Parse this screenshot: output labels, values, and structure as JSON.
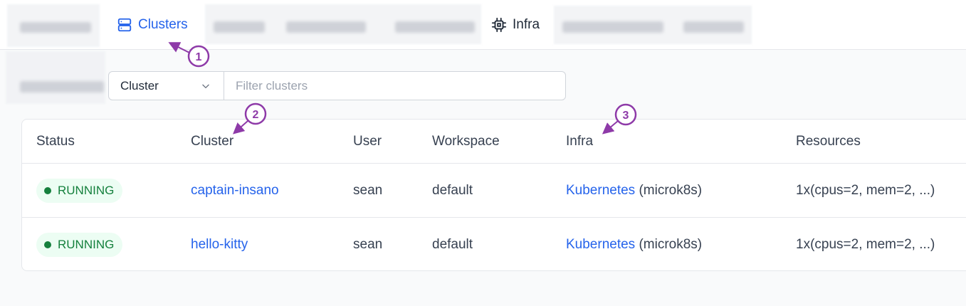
{
  "nav": {
    "tabs": [
      {
        "label": "Clusters",
        "icon": "server-stack-icon",
        "active": true
      },
      {
        "label": "Infra",
        "icon": "chip-icon",
        "active": false
      }
    ]
  },
  "filter": {
    "select_value": "Cluster",
    "placeholder": "Filter clusters"
  },
  "table": {
    "columns": [
      "Status",
      "Cluster",
      "User",
      "Workspace",
      "Infra",
      "Resources"
    ],
    "rows": [
      {
        "status": "RUNNING",
        "cluster": "captain-insano",
        "user": "sean",
        "workspace": "default",
        "infra_link": "Kubernetes",
        "infra_detail": "(microk8s)",
        "resources": "1x(cpus=2, mem=2, ...)"
      },
      {
        "status": "RUNNING",
        "cluster": "hello-kitty",
        "user": "sean",
        "workspace": "default",
        "infra_link": "Kubernetes",
        "infra_detail": "(microk8s)",
        "resources": "1x(cpus=2, mem=2, ...)"
      }
    ]
  },
  "annotations": [
    "1",
    "2",
    "3"
  ],
  "colors": {
    "accent": "#2563eb",
    "running": "#15803d",
    "running_bg": "#ecfdf3",
    "annotation": "#8e3aa8"
  }
}
